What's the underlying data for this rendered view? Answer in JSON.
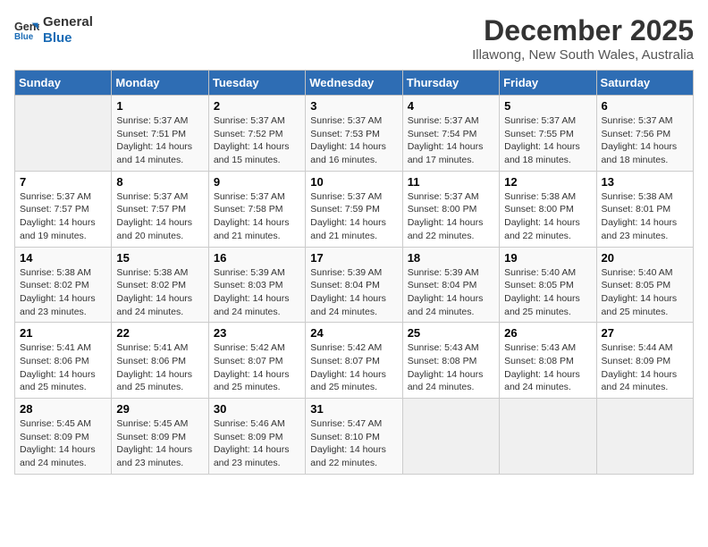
{
  "logo": {
    "line1": "General",
    "line2": "Blue"
  },
  "title": "December 2025",
  "subtitle": "Illawong, New South Wales, Australia",
  "days_of_week": [
    "Sunday",
    "Monday",
    "Tuesday",
    "Wednesday",
    "Thursday",
    "Friday",
    "Saturday"
  ],
  "weeks": [
    [
      {
        "day": "",
        "info": ""
      },
      {
        "day": "1",
        "info": "Sunrise: 5:37 AM\nSunset: 7:51 PM\nDaylight: 14 hours\nand 14 minutes."
      },
      {
        "day": "2",
        "info": "Sunrise: 5:37 AM\nSunset: 7:52 PM\nDaylight: 14 hours\nand 15 minutes."
      },
      {
        "day": "3",
        "info": "Sunrise: 5:37 AM\nSunset: 7:53 PM\nDaylight: 14 hours\nand 16 minutes."
      },
      {
        "day": "4",
        "info": "Sunrise: 5:37 AM\nSunset: 7:54 PM\nDaylight: 14 hours\nand 17 minutes."
      },
      {
        "day": "5",
        "info": "Sunrise: 5:37 AM\nSunset: 7:55 PM\nDaylight: 14 hours\nand 18 minutes."
      },
      {
        "day": "6",
        "info": "Sunrise: 5:37 AM\nSunset: 7:56 PM\nDaylight: 14 hours\nand 18 minutes."
      }
    ],
    [
      {
        "day": "7",
        "info": "Sunrise: 5:37 AM\nSunset: 7:57 PM\nDaylight: 14 hours\nand 19 minutes."
      },
      {
        "day": "8",
        "info": "Sunrise: 5:37 AM\nSunset: 7:57 PM\nDaylight: 14 hours\nand 20 minutes."
      },
      {
        "day": "9",
        "info": "Sunrise: 5:37 AM\nSunset: 7:58 PM\nDaylight: 14 hours\nand 21 minutes."
      },
      {
        "day": "10",
        "info": "Sunrise: 5:37 AM\nSunset: 7:59 PM\nDaylight: 14 hours\nand 21 minutes."
      },
      {
        "day": "11",
        "info": "Sunrise: 5:37 AM\nSunset: 8:00 PM\nDaylight: 14 hours\nand 22 minutes."
      },
      {
        "day": "12",
        "info": "Sunrise: 5:38 AM\nSunset: 8:00 PM\nDaylight: 14 hours\nand 22 minutes."
      },
      {
        "day": "13",
        "info": "Sunrise: 5:38 AM\nSunset: 8:01 PM\nDaylight: 14 hours\nand 23 minutes."
      }
    ],
    [
      {
        "day": "14",
        "info": "Sunrise: 5:38 AM\nSunset: 8:02 PM\nDaylight: 14 hours\nand 23 minutes."
      },
      {
        "day": "15",
        "info": "Sunrise: 5:38 AM\nSunset: 8:02 PM\nDaylight: 14 hours\nand 24 minutes."
      },
      {
        "day": "16",
        "info": "Sunrise: 5:39 AM\nSunset: 8:03 PM\nDaylight: 14 hours\nand 24 minutes."
      },
      {
        "day": "17",
        "info": "Sunrise: 5:39 AM\nSunset: 8:04 PM\nDaylight: 14 hours\nand 24 minutes."
      },
      {
        "day": "18",
        "info": "Sunrise: 5:39 AM\nSunset: 8:04 PM\nDaylight: 14 hours\nand 24 minutes."
      },
      {
        "day": "19",
        "info": "Sunrise: 5:40 AM\nSunset: 8:05 PM\nDaylight: 14 hours\nand 25 minutes."
      },
      {
        "day": "20",
        "info": "Sunrise: 5:40 AM\nSunset: 8:05 PM\nDaylight: 14 hours\nand 25 minutes."
      }
    ],
    [
      {
        "day": "21",
        "info": "Sunrise: 5:41 AM\nSunset: 8:06 PM\nDaylight: 14 hours\nand 25 minutes."
      },
      {
        "day": "22",
        "info": "Sunrise: 5:41 AM\nSunset: 8:06 PM\nDaylight: 14 hours\nand 25 minutes."
      },
      {
        "day": "23",
        "info": "Sunrise: 5:42 AM\nSunset: 8:07 PM\nDaylight: 14 hours\nand 25 minutes."
      },
      {
        "day": "24",
        "info": "Sunrise: 5:42 AM\nSunset: 8:07 PM\nDaylight: 14 hours\nand 25 minutes."
      },
      {
        "day": "25",
        "info": "Sunrise: 5:43 AM\nSunset: 8:08 PM\nDaylight: 14 hours\nand 24 minutes."
      },
      {
        "day": "26",
        "info": "Sunrise: 5:43 AM\nSunset: 8:08 PM\nDaylight: 14 hours\nand 24 minutes."
      },
      {
        "day": "27",
        "info": "Sunrise: 5:44 AM\nSunset: 8:09 PM\nDaylight: 14 hours\nand 24 minutes."
      }
    ],
    [
      {
        "day": "28",
        "info": "Sunrise: 5:45 AM\nSunset: 8:09 PM\nDaylight: 14 hours\nand 24 minutes."
      },
      {
        "day": "29",
        "info": "Sunrise: 5:45 AM\nSunset: 8:09 PM\nDaylight: 14 hours\nand 23 minutes."
      },
      {
        "day": "30",
        "info": "Sunrise: 5:46 AM\nSunset: 8:09 PM\nDaylight: 14 hours\nand 23 minutes."
      },
      {
        "day": "31",
        "info": "Sunrise: 5:47 AM\nSunset: 8:10 PM\nDaylight: 14 hours\nand 22 minutes."
      },
      {
        "day": "",
        "info": ""
      },
      {
        "day": "",
        "info": ""
      },
      {
        "day": "",
        "info": ""
      }
    ]
  ]
}
